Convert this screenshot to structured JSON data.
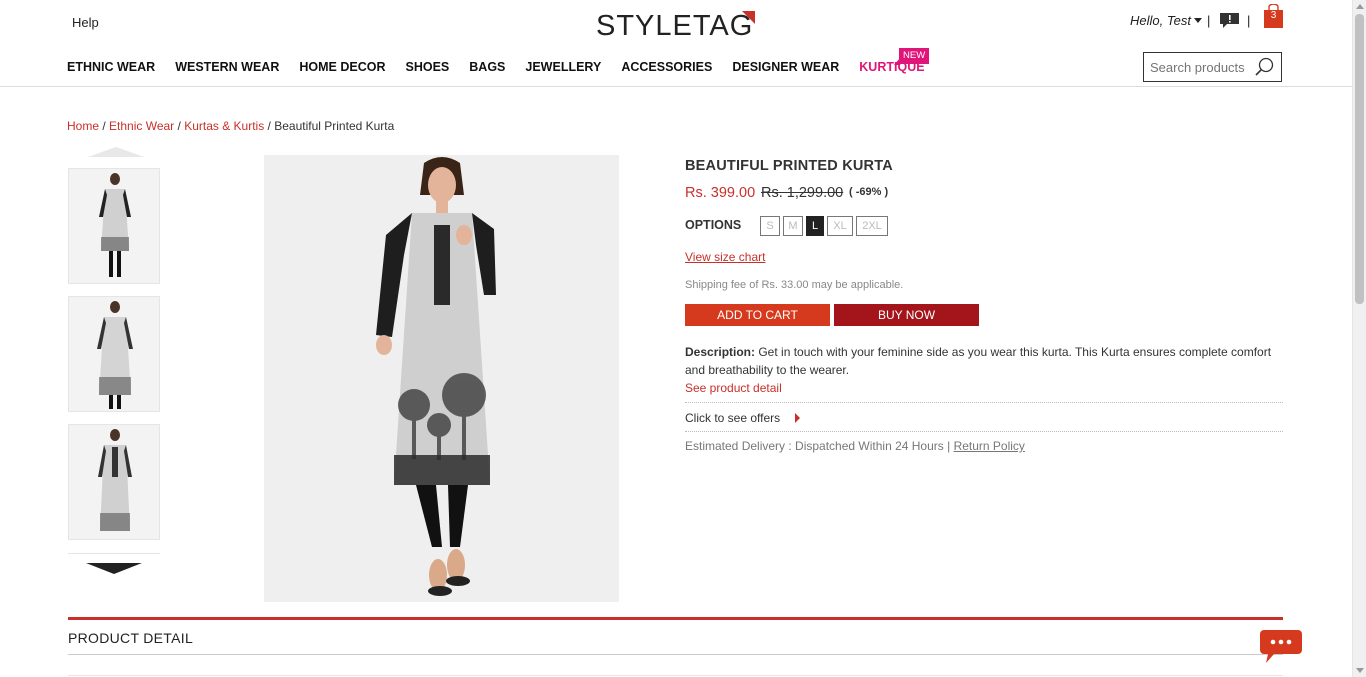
{
  "header": {
    "help": "Help",
    "logo_text": "STYLETAG",
    "greeting": "Hello, Test",
    "separator": "|",
    "cart_count": "3",
    "new_badge": "NEW"
  },
  "nav": {
    "items": [
      "ETHNIC WEAR",
      "WESTERN WEAR",
      "HOME DECOR",
      "SHOES",
      "BAGS",
      "JEWELLERY",
      "ACCESSORIES",
      "DESIGNER WEAR",
      "KURTIQUE"
    ]
  },
  "search": {
    "placeholder": "Search products"
  },
  "breadcrumb": {
    "items": [
      "Home",
      "Ethnic Wear",
      "Kurtas & Kurtis"
    ],
    "separator": " / ",
    "current": "Beautiful Printed Kurta"
  },
  "product": {
    "title": "BEAUTIFUL PRINTED KURTA",
    "price": "Rs. 399.00",
    "mrp": "Rs. 1,299.00",
    "discount": "( -69% )",
    "options_label": "OPTIONS",
    "sizes": [
      "S",
      "M",
      "L",
      "XL",
      "2XL"
    ],
    "selected_size": "L",
    "size_chart": "View size chart",
    "shipping": "Shipping fee of Rs. 33.00 may be applicable.",
    "add_to_cart": "ADD TO CART",
    "buy_now": "BUY NOW",
    "description_label": "Description:",
    "description": " Get in touch with your feminine side as you wear this kurta. This Kurta ensures complete comfort and breathability to the wearer.",
    "see_detail": "See product detail",
    "offers": "Click to see offers",
    "delivery": "Estimated Delivery : Dispatched Within 24 Hours | ",
    "return_policy": "Return Policy"
  },
  "product_detail": {
    "title": "PRODUCT DETAIL"
  },
  "colors": {
    "accent": "#c8302a",
    "buy": "#a3151b",
    "kurtique": "#e0157a"
  },
  "icons": [
    "search-icon",
    "notification-icon",
    "cart-icon",
    "chat-icon",
    "caret-down-icon"
  ]
}
